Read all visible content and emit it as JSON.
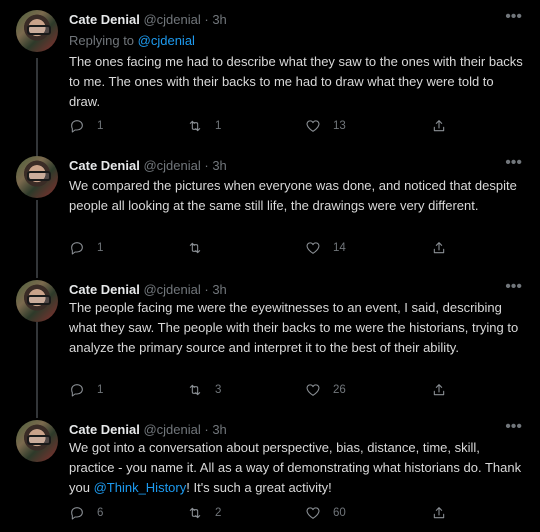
{
  "tweets": [
    {
      "name": "Cate Denial",
      "handle": "@cjdenial",
      "sep": "·",
      "time": "3h",
      "replying_prefix": "Replying to ",
      "replying_handle": "@cjdenial",
      "text": "The ones facing me had to describe what they saw to the ones with their backs to me.  The ones with their backs to me had to draw what they were told to draw.",
      "replies": "1",
      "retweets": "1",
      "likes": "13"
    },
    {
      "name": "Cate Denial",
      "handle": "@cjdenial",
      "sep": "·",
      "time": "3h",
      "text": "We compared the pictures when everyone was done, and noticed that despite people all looking at the same still life, the drawings were very different.",
      "replies": "1",
      "retweets": "",
      "likes": "14"
    },
    {
      "name": "Cate Denial",
      "handle": "@cjdenial",
      "sep": "·",
      "time": "3h",
      "text": "The people facing me were the eyewitnesses to an event, I said, describing what they saw. The people with their backs to me were the historians, trying to analyze the primary source and interpret it to the best of their ability.",
      "replies": "1",
      "retweets": "3",
      "likes": "26"
    },
    {
      "name": "Cate Denial",
      "handle": "@cjdenial",
      "sep": "·",
      "time": "3h",
      "text_before": "We got into a conversation about perspective, bias, distance, time, skill, practice - you name it. All as a way of demonstrating what historians do. Thank you ",
      "mention": "@Think_History",
      "text_after": "!  It's such a great activity!",
      "replies": "6",
      "retweets": "2",
      "likes": "60"
    }
  ],
  "icons": {
    "more": "more-horizontal-icon",
    "reply": "reply-icon",
    "retweet": "retweet-icon",
    "like": "heart-icon",
    "share": "share-icon"
  },
  "colors": {
    "background": "#000000",
    "text": "#d9d9d9",
    "secondary": "#71767b",
    "link": "#1d9bf0"
  }
}
